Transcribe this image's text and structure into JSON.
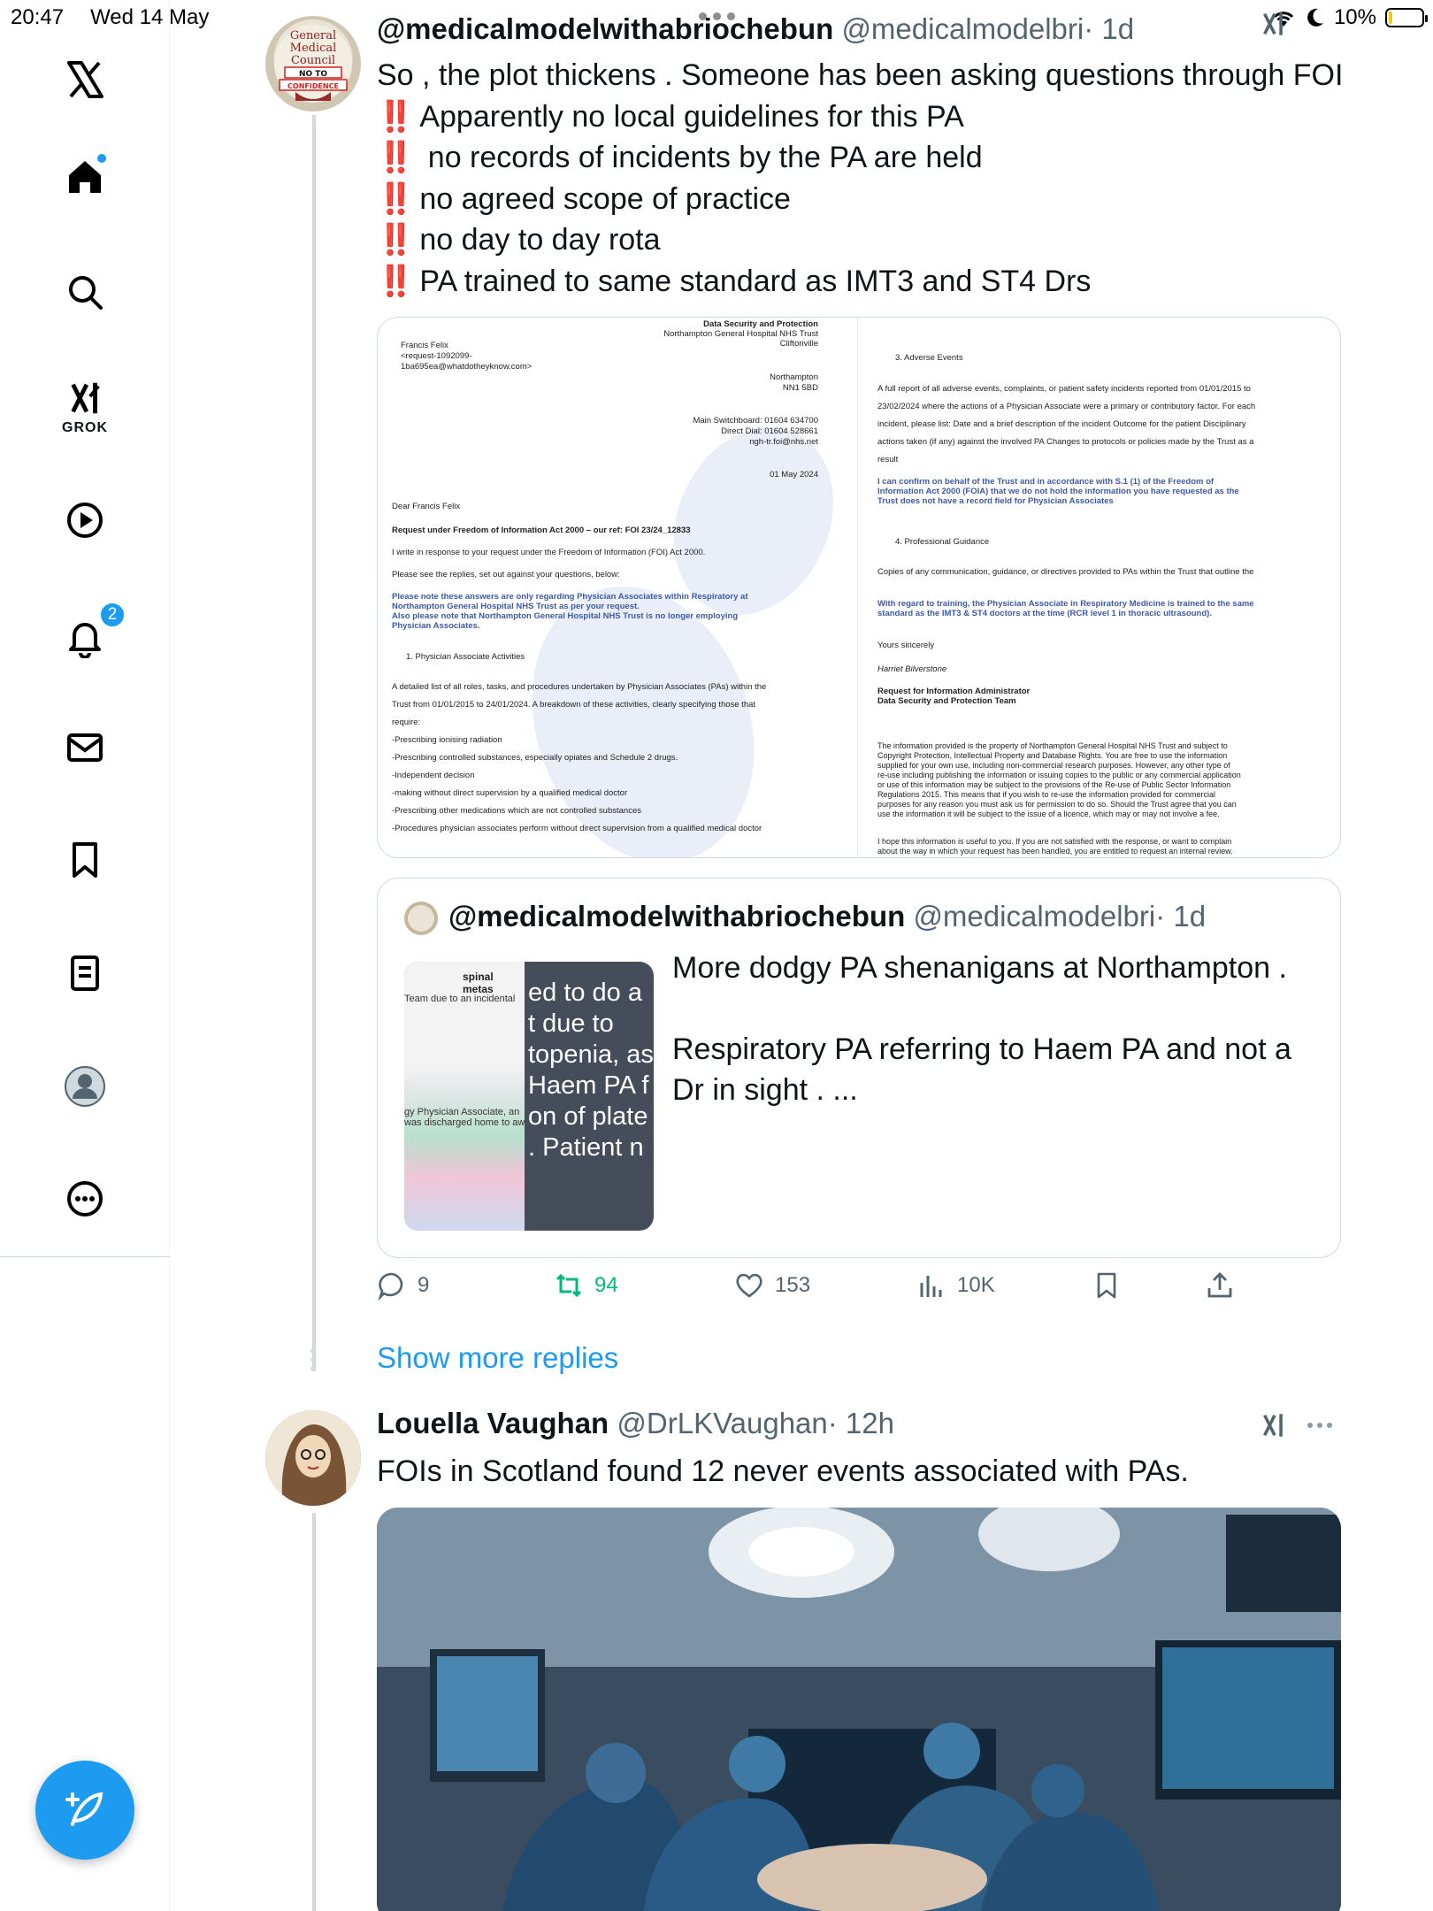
{
  "status_bar": {
    "time": "20:47",
    "date": "Wed 14 May",
    "battery": "10%",
    "battery_level": 0.1
  },
  "sidebar": {
    "grok_label": "GROK",
    "notifications_count": "2",
    "items": [
      "x-logo",
      "home",
      "search",
      "grok",
      "video",
      "notifications",
      "messages",
      "bookmarks",
      "lists",
      "profile",
      "more"
    ]
  },
  "tweet1": {
    "name": "@medicalmodelwithabriochebun",
    "handle": "@medicalmodelbri",
    "time": "· 1d",
    "line1": "So , the plot thickens . Someone has been asking questions through FOI",
    "bang": "‼️",
    "bullets": [
      "Apparently no local guidelines for  this PA",
      " no records of incidents by the PA are held",
      "no agreed scope of practice",
      "no day to day rota",
      "PA trained to same standard as IMT3 and ST4 Drs"
    ],
    "avatar_text": [
      "General",
      "Medical",
      "Council",
      "NO TO",
      "CONFIDENCE"
    ]
  },
  "document": {
    "left": {
      "org1": "Data Security and Protection",
      "org2": "Northampton General Hospital NHS Trust",
      "org3": "Cliftonville",
      "to1": "Francis Felix",
      "to2": "<request-1092099-",
      "to3": "1ba695ea@whatdotheyknow.com>",
      "town": "Northampton",
      "postcode": "NN1 5BD",
      "switch": "Main Switchboard: 01604 634700",
      "direct": "Direct Dial: 01604 528661",
      "email": "ngh-tr.foi@nhs.net",
      "date": "01 May 2024",
      "dear": "Dear Francis Felix",
      "subject": "Request under Freedom of Information Act 2000 – our ref: FOI 23/24_12833",
      "p1": "I write in response to your request under the Freedom of Information (FOI) Act 2000.",
      "p2": "Please see the replies, set out against your questions, below:",
      "note1": "Please note these answers are only regarding Physician Associates within Respiratory at",
      "note2": "Northampton General Hospital NHS Trust as per your request.",
      "note3": "Also please note that Northampton General Hospital NHS Trust is no longer employing",
      "note4": "Physician Associates.",
      "section1": "1.    Physician Associate Activities",
      "a1": "A detailed list of all roles, tasks, and procedures undertaken by Physician Associates (PAs) within the",
      "a2": "Trust from 01/01/2015 to 24/01/2024. A breakdown of these activities, clearly specifying those that",
      "a3": "require:",
      "b1": "-Prescribing ionising radiation",
      "b2": "-Prescribing controlled substances, especially opiates and Schedule 2 drugs.",
      "b3": "-Independent decision",
      "b4": "-making without direct supervision by a qualified medical doctor",
      "b5": "-Prescribing other medications which are not controlled substances",
      "b6": "-Procedures physician associates perform without direct supervision from a qualified medical doctor"
    },
    "right": {
      "section3": "3.    Adverse Events",
      "r1": "A full report of all adverse events, complaints, or patient safety incidents reported from 01/01/2015 to",
      "r2": "23/02/2024 where the actions of a Physician Associate were a primary or contributory factor. For each",
      "r3": "incident, please list: Date and a brief description of the incident Outcome for the patient Disciplinary",
      "r4": "actions taken (if any) against the involved PA Changes to protocols or policies made by the Trust as a",
      "r5": "result",
      "ans1": "I can confirm on behalf of the Trust and in accordance with S.1 (1) of the Freedom of",
      "ans2": "Information Act 2000 (FOIA) that we do not hold the information you have requested as the",
      "ans3": "Trust does not have a record field for Physician Associates",
      "section4": "4.    Professional Guidance",
      "g1": "Copies of any communication, guidance, or directives provided to PAs within the Trust that outline the",
      "tr1": "With regard to training, the Physician Associate in Respiratory Medicine is trained to the same",
      "tr2": "standard as the IMT3 & ST4 doctors at the time (RCR level 1 in thoracic ultrasound).",
      "yours": "Yours sincerely",
      "sig": "Harriet Bilverstone",
      "role1": "Request for Information Administrator",
      "role2": "Data Security and Protection Team",
      "c1": "The information provided is the property of Northampton General Hospital NHS Trust and subject to",
      "c2": "Copyright Protection, Intellectual Property and Database Rights. You are free to use the information",
      "c3": "supplied for your own use, including non-commercial research purposes. However, any other type of",
      "c4": "re-use including publishing the information or issuing copies to the public or any commercial application",
      "c5": "or use of this information may be subject to the provisions of the Re-use of Public Sector Information",
      "c6": "Regulations 2015. This means that if you wish to re-use the information provided for commercial",
      "c7": "purposes for any reason you must ask us for permission to do so. Should the Trust agree that you can",
      "c8": "use the information it will be subject to the issue of a licence, which may or may not involve a fee.",
      "h1": "I hope this information is useful to you. If you are not satisfied with the response, or want to complain",
      "h2": "about the way in which your request has been handled, you are entitled to request an internal review."
    }
  },
  "quote": {
    "name": "@medicalmodelwithabriochebun",
    "handle": "@medicalmodelbri",
    "time": "· 1d",
    "line1": "More dodgy PA shenanigans at Northampton .",
    "line2": "Respiratory PA referring to Haem PA and not a",
    "line3": "Dr in sight . ...",
    "img_left_top": "spinal metas",
    "img_left_1": "Team due to an incidental",
    "img_left_2": "gy Physician Associate, an",
    "img_left_3": "was discharged home to aw",
    "img_right": [
      "ed to do a",
      "t due to",
      "topenia, as",
      "Haem PA f",
      "on of plate",
      ". Patient n"
    ]
  },
  "actions": {
    "replies": "9",
    "reposts": "94",
    "likes": "153",
    "views": "10K"
  },
  "show_more": "Show more replies",
  "tweet2": {
    "name": "Louella Vaughan",
    "handle": "@DrLKVaughan",
    "time": "· 12h",
    "text": "FOIs in Scotland found 12 never events associated with PAs."
  },
  "colors": {
    "accent": "#1d9bf0",
    "repost": "#00ba7c",
    "text": "#0f1419",
    "muted": "#536471",
    "border": "#cfd9de"
  }
}
